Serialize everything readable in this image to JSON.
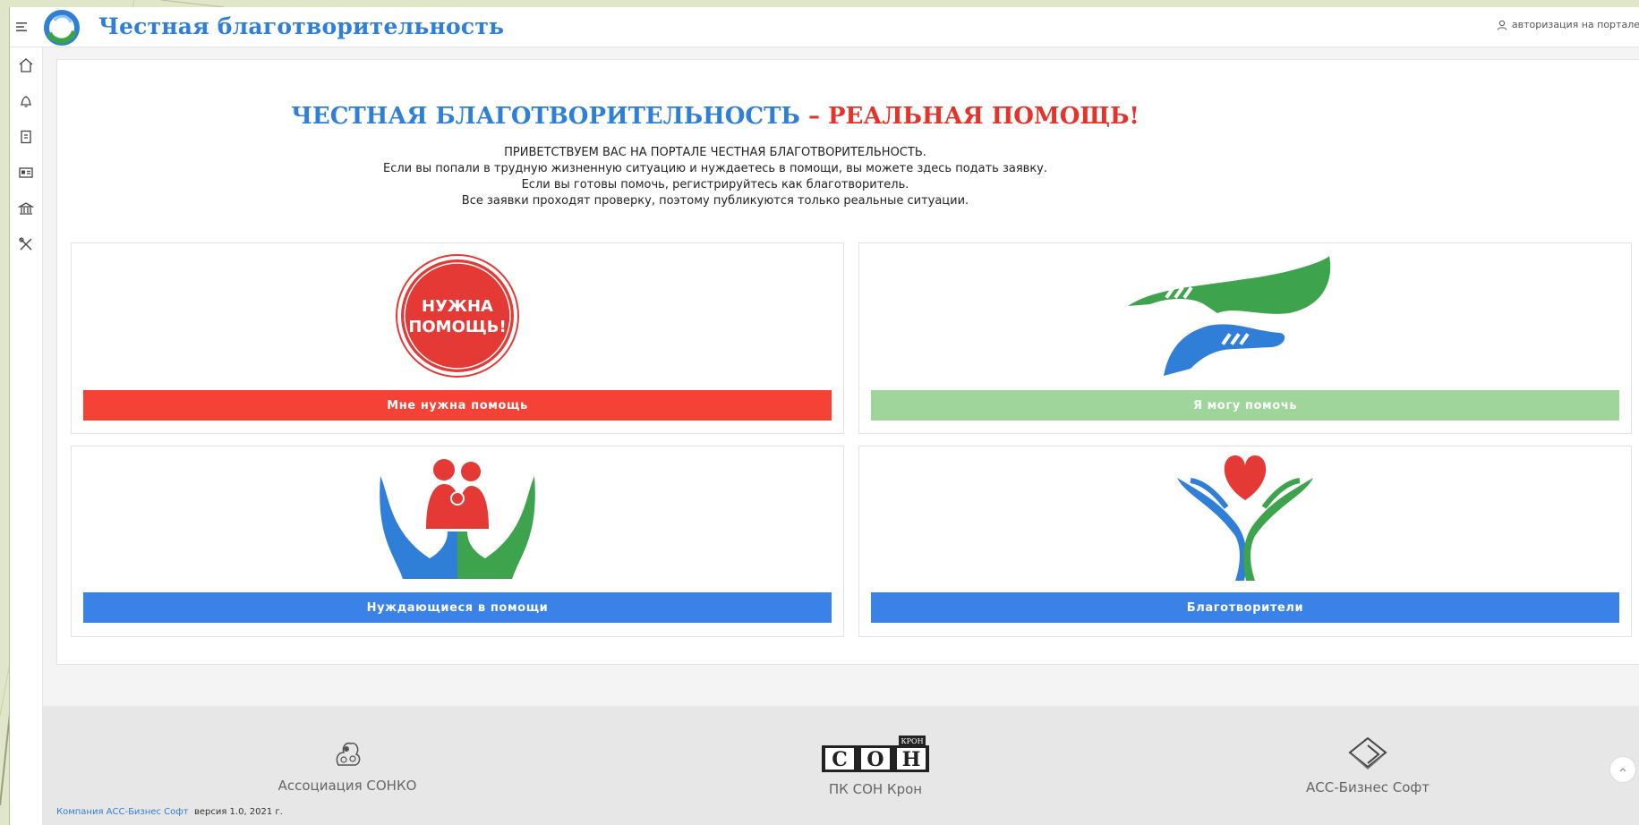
{
  "header": {
    "title": "Честная благотворительность",
    "login_label": "авторизация на портале"
  },
  "sidebar": {
    "items": [
      {
        "icon": "home-icon"
      },
      {
        "icon": "bell-icon"
      },
      {
        "icon": "book-icon"
      },
      {
        "icon": "id-card-icon"
      },
      {
        "icon": "bank-icon"
      },
      {
        "icon": "tools-icon"
      }
    ]
  },
  "hero": {
    "title_blue": "ЧЕСТНАЯ БЛАГОТВОРИТЕЛЬНОСТЬ",
    "title_dash": " – ",
    "title_red": "РЕАЛЬНАЯ ПОМОЩЬ!",
    "lines": [
      "ПРИВЕТСТВУЕМ ВАС НА ПОРТАЛЕ ЧЕСТНАЯ БЛАГОТВОРИТЕЛЬНОСТЬ.",
      "Если вы попали в трудную жизненную ситуацию и нуждаетесь в помощи, вы можете здесь подать заявку.",
      "Если вы готовы помочь, регистрируйтесь как благотворитель.",
      "Все заявки проходят проверку, поэтому публикуются только реальные ситуации."
    ]
  },
  "cards": [
    {
      "button": "Мне нужна помощь",
      "badge_line1": "НУЖНА",
      "badge_line2": "ПОМОЩЬ!"
    },
    {
      "button": "Я могу помочь"
    },
    {
      "button": "Нуждающиеся в помощи"
    },
    {
      "button": "Благотворители"
    }
  ],
  "footer": {
    "partners": [
      {
        "label": "Ассоциация СОНКО",
        "icon": "sonko-logo-icon"
      },
      {
        "label": "ПК СОН Крон",
        "icon": "son-kron-logo-icon",
        "logo_text": "С.О.Н.",
        "logo_badge": "КРОН"
      },
      {
        "label": "АСС-Бизнес Софт",
        "icon": "acc-logo-icon"
      }
    ],
    "company_link": "Компания АСС-Бизнес Софт",
    "version_text": "версия 1.0, 2021 г."
  },
  "colors": {
    "brand_blue": "#2f7fd8",
    "accent_red": "#f44336",
    "accent_green": "#9fd49a",
    "button_blue": "#3a82e8"
  }
}
